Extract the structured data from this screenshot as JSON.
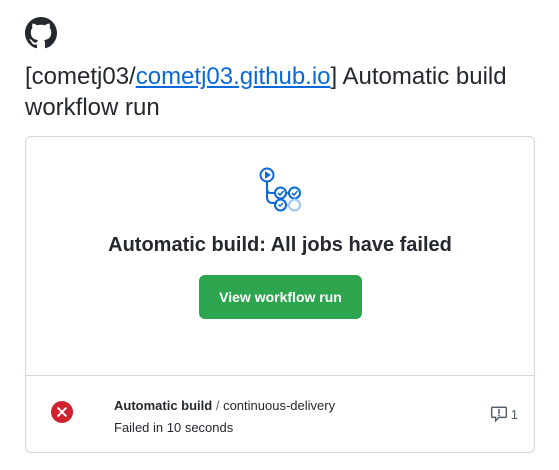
{
  "header": {
    "logo_icon": "github-mark-icon",
    "subject_prefix": "[cometj03/",
    "repo_link": "cometj03.github.io",
    "subject_suffix": "] Automatic build workflow run"
  },
  "card": {
    "icon": "github-actions-workflow-icon",
    "headline": "Automatic build: All jobs have failed",
    "cta_label": "View workflow run",
    "cta_color": "#2da44e"
  },
  "job": {
    "status_icon": "failed-x-circle-icon",
    "status_color": "#cf222e",
    "workflow": "Automatic build",
    "separator": " / ",
    "job_name": "continuous-delivery",
    "duration": "Failed in 10 seconds",
    "annotation_icon": "comment-alert-icon",
    "annotation_count": "1"
  }
}
